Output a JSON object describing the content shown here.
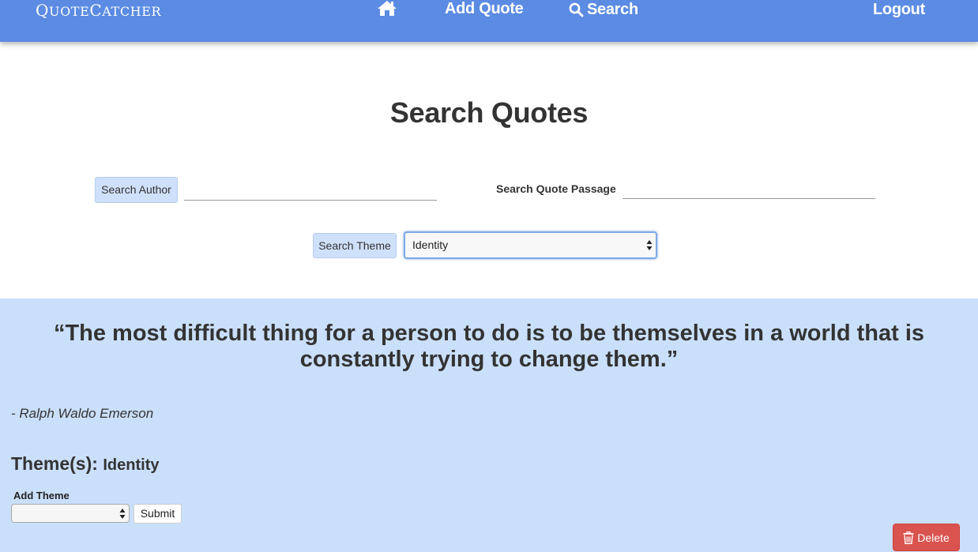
{
  "nav": {
    "brand_first": "Q",
    "brand_rest": "UOTE",
    "brand_second_first": "C",
    "brand_second_rest": "ATCHER",
    "home_icon": "home-icon",
    "add_quote": "Add Quote",
    "search": "Search",
    "search_icon": "search-icon",
    "logout": "Logout"
  },
  "search": {
    "title": "Search Quotes",
    "author_button": "Search Author",
    "author_value": "",
    "passage_label": "Search Quote Passage",
    "passage_value": "",
    "theme_button": "Search Theme",
    "theme_selected": "Identity"
  },
  "quote": {
    "text": "“The most difficult thing for a person to do is to be themselves in a world that is constantly trying to change them.”",
    "author": "- Ralph Waldo Emerson",
    "themes_label": "Theme(s):",
    "themes_value": "Identity",
    "add_theme_label": "Add Theme",
    "add_theme_selected": "",
    "submit_label": "Submit",
    "delete_label": "Delete",
    "delete_icon": "trash-icon"
  },
  "colors": {
    "navbar": "#5b8be3",
    "card": "#cadffa",
    "button_light": "#cfe0fb",
    "delete": "#d9534f"
  }
}
